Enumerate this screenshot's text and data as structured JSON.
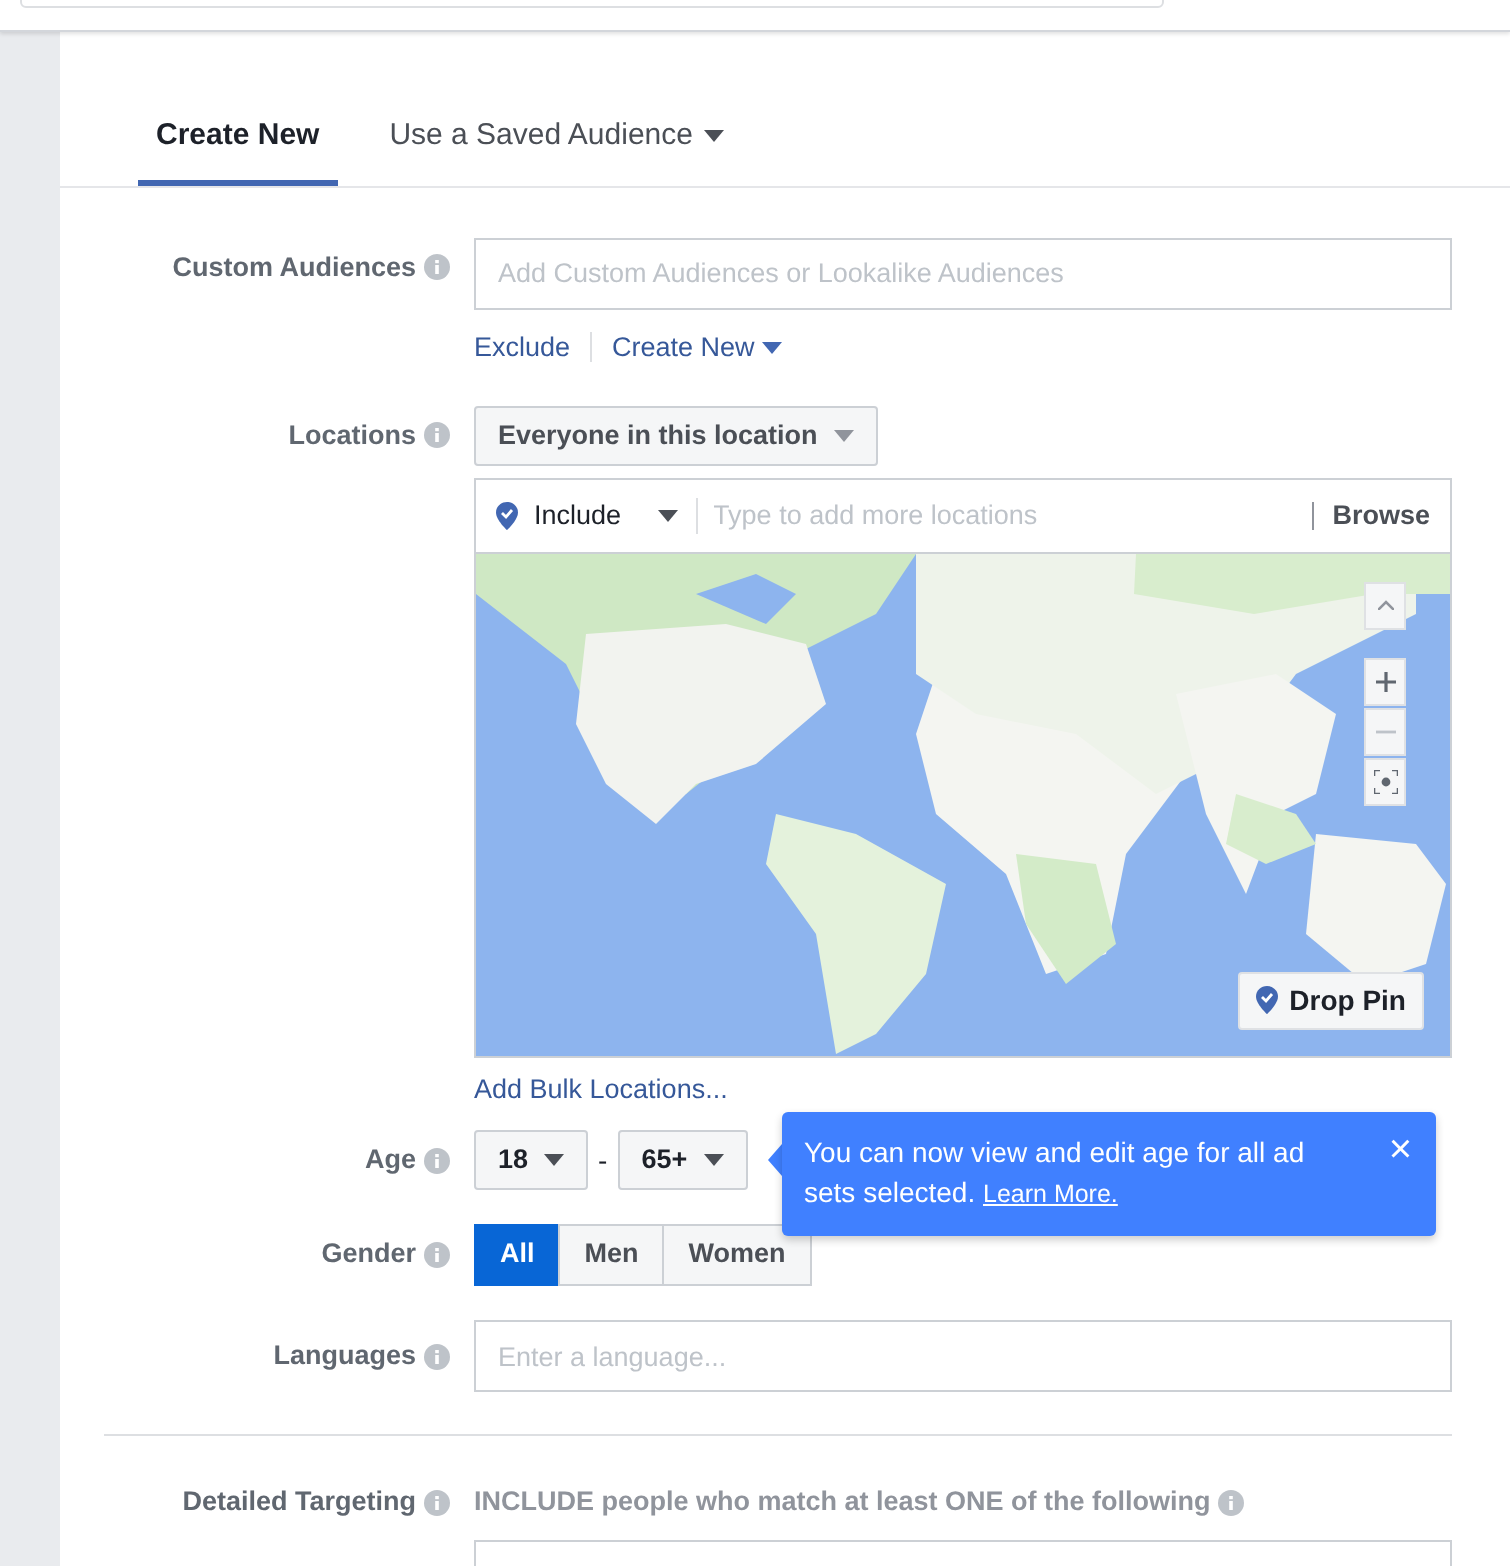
{
  "tabs": [
    {
      "label": "Create New",
      "selected": true,
      "has_menu": false
    },
    {
      "label": "Use a Saved Audience",
      "selected": false,
      "has_menu": true
    }
  ],
  "custom_audiences": {
    "label": "Custom Audiences",
    "placeholder": "Add Custom Audiences or Lookalike Audiences",
    "links": [
      {
        "label": "Exclude",
        "has_menu": false
      },
      {
        "label": "Create New",
        "has_menu": true
      }
    ]
  },
  "locations": {
    "label": "Locations",
    "filter": "Everyone in this location",
    "include": "Include",
    "placeholder": "Type to add more locations",
    "browse": "Browse",
    "drop_pin": "Drop Pin",
    "bulk_link": "Add Bulk Locations..."
  },
  "age": {
    "label": "Age",
    "min": "18",
    "separator": "-",
    "max": "65+"
  },
  "tooltip": {
    "text": "You can now view and edit age for all ad sets selected.",
    "link": "Learn More.",
    "close": "×"
  },
  "gender": {
    "label": "Gender",
    "options": [
      {
        "label": "All",
        "selected": true
      },
      {
        "label": "Men",
        "selected": false
      },
      {
        "label": "Women",
        "selected": false
      }
    ]
  },
  "languages": {
    "label": "Languages",
    "placeholder": "Enter a language..."
  },
  "detailed_targeting": {
    "label": "Detailed Targeting",
    "instruction": "INCLUDE people who match at least ONE of the following"
  }
}
